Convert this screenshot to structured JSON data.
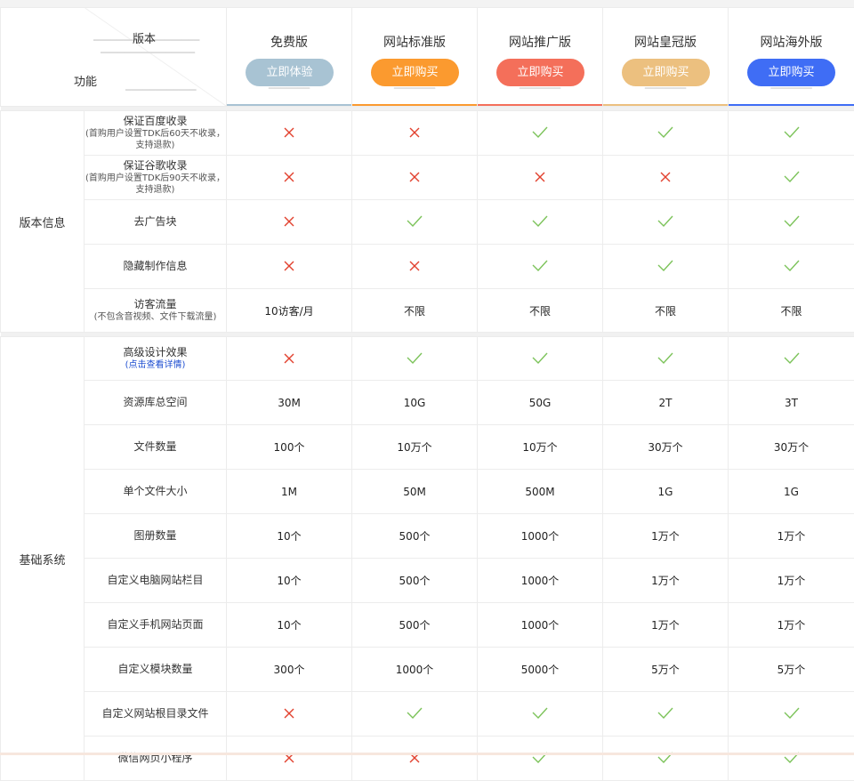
{
  "header": {
    "version_label": "版本",
    "feature_label": "功能",
    "plans": [
      {
        "name": "免费版",
        "button": "立即体验",
        "color": "#a8c3d3",
        "line": "#a8c3d3"
      },
      {
        "name": "网站标准版",
        "button": "立即购买",
        "color": "#fb9a2f",
        "line": "#fb9a2f"
      },
      {
        "name": "网站推广版",
        "button": "立即购买",
        "color": "#f46f5a",
        "line": "#f46f5a"
      },
      {
        "name": "网站皇冠版",
        "button": "立即购买",
        "color": "#ecc07f",
        "line": "#ecc07f"
      },
      {
        "name": "网站海外版",
        "button": "立即购买",
        "color": "#3f6df5",
        "line": "#3f6df5"
      }
    ]
  },
  "sections": [
    {
      "name": "版本信息",
      "rows": [
        {
          "feature": "保证百度收录",
          "note": "(首购用户设置TDK后60天不收录，支持退款)",
          "values": [
            "x",
            "x",
            "ok",
            "ok",
            "ok"
          ]
        },
        {
          "feature": "保证谷歌收录",
          "note": "(首购用户设置TDK后90天不收录，支持退款)",
          "values": [
            "x",
            "x",
            "x",
            "x",
            "ok"
          ]
        },
        {
          "feature": "去广告块",
          "values": [
            "x",
            "ok",
            "ok",
            "ok",
            "ok"
          ]
        },
        {
          "feature": "隐藏制作信息",
          "values": [
            "x",
            "x",
            "ok",
            "ok",
            "ok"
          ]
        },
        {
          "feature": "访客流量",
          "note": "(不包含音视频、文件下载流量)",
          "values": [
            "10访客/月",
            "不限",
            "不限",
            "不限",
            "不限"
          ]
        }
      ]
    },
    {
      "name": "基础系统",
      "rows": [
        {
          "feature": "高级设计效果",
          "link": "(点击查看详情)",
          "values": [
            "x",
            "ok",
            "ok",
            "ok",
            "ok"
          ]
        },
        {
          "feature": "资源库总空间",
          "values": [
            "30M",
            "10G",
            "50G",
            "2T",
            "3T"
          ]
        },
        {
          "feature": "文件数量",
          "values": [
            "100个",
            "10万个",
            "10万个",
            "30万个",
            "30万个"
          ]
        },
        {
          "feature": "单个文件大小",
          "values": [
            "1M",
            "50M",
            "500M",
            "1G",
            "1G"
          ]
        },
        {
          "feature": "图册数量",
          "values": [
            "10个",
            "500个",
            "1000个",
            "1万个",
            "1万个"
          ]
        },
        {
          "feature": "自定义电脑网站栏目",
          "values": [
            "10个",
            "500个",
            "1000个",
            "1万个",
            "1万个"
          ]
        },
        {
          "feature": "自定义手机网站页面",
          "values": [
            "10个",
            "500个",
            "1000个",
            "1万个",
            "1万个"
          ]
        },
        {
          "feature": "自定义模块数量",
          "values": [
            "300个",
            "1000个",
            "5000个",
            "5万个",
            "5万个"
          ]
        },
        {
          "feature": "自定义网站根目录文件",
          "values": [
            "x",
            "ok",
            "ok",
            "ok",
            "ok"
          ]
        },
        {
          "feature": "微信网页小程序",
          "values": [
            "x",
            "x",
            "ok",
            "ok",
            "ok"
          ]
        }
      ]
    }
  ],
  "icons": {
    "x": "cross-icon",
    "ok": "check-icon"
  },
  "colors": {
    "cross": "#e2412f",
    "check": "#7cc35a"
  }
}
